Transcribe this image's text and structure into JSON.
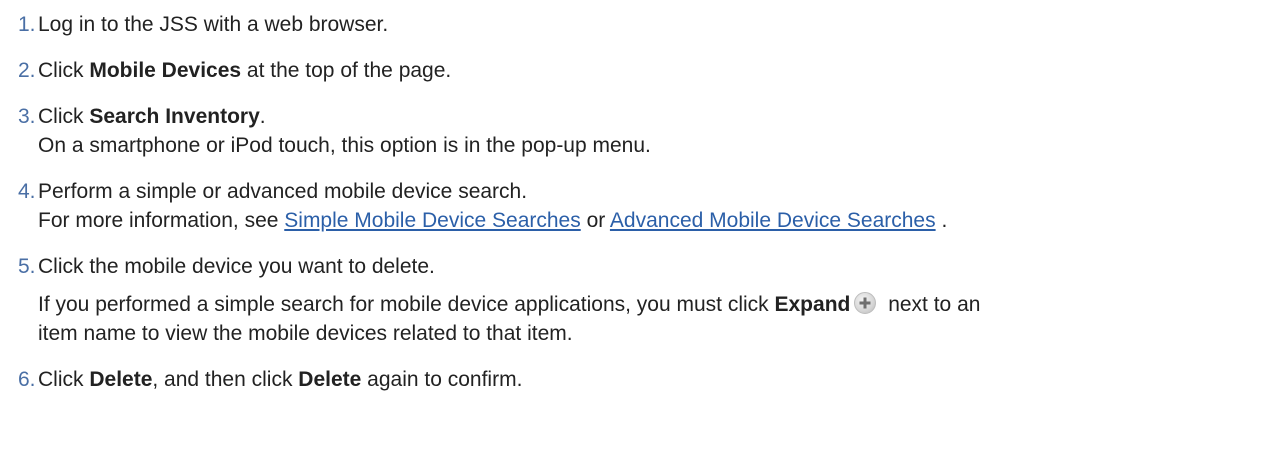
{
  "steps": [
    {
      "num": "1.",
      "text": "Log in to the JSS with a web browser."
    },
    {
      "num": "2.",
      "pre": "Click ",
      "bold": "Mobile Devices",
      "post": " at the top of the page."
    },
    {
      "num": "3.",
      "pre": "Click ",
      "bold": "Search Inventory",
      "post": ".",
      "note": "On a smartphone or iPod touch, this option is in the pop-up menu."
    },
    {
      "num": "4.",
      "text": "Perform a simple or advanced mobile device search.",
      "note_pre": "For more information, see ",
      "link1": "Simple Mobile Device Searches",
      "note_mid": " or ",
      "link2": "Advanced Mobile Device Searches",
      "note_post": " ."
    },
    {
      "num": "5.",
      "text": "Click the mobile device you want to delete.",
      "note_pre": "If you performed a simple search for mobile device applications, you must click ",
      "note_bold": "Expand",
      "note_icon": "plus-circle-icon",
      "note_post": " next to an",
      "note_line2": "item name to view the mobile devices related to that item."
    },
    {
      "num": "6.",
      "pre": "Click ",
      "bold": "Delete",
      "mid": ", and then click ",
      "bold2": "Delete",
      "post": " again to confirm."
    }
  ],
  "colors": {
    "text": "#222222",
    "step_number": "#4a6fa5",
    "link": "#2b5fa8"
  }
}
